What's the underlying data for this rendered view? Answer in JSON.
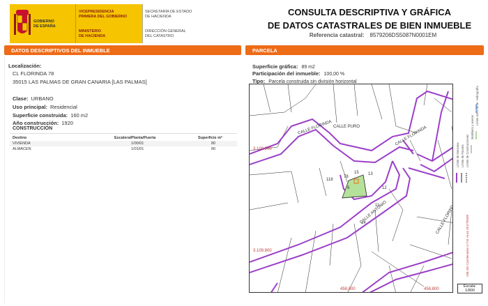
{
  "header": {
    "gobierno": "GOBIERNO\nDE ESPAÑA",
    "vicepresidencia": "VICEPRESIDENCIA\nPRIMERA DEL GOBIERNO",
    "ministerio": "MINISTERIO\nDE HACIENDA",
    "secretaria": "SECRETARÍA DE ESTADO\nDE HACIENDA",
    "direccion": "DIRECCIÓN GENERAL\nDEL CATASTRO",
    "title_line1": "CONSULTA DESCRIPTIVA Y GRÁFICA",
    "title_line2": "DE DATOS CATASTRALES DE BIEN INMUEBLE",
    "ref_label": "Referencia catastral:",
    "ref_value": "8579206DS5087N0001EM",
    "brand_yellow": "#f6c400",
    "accent_orange": "#ee6b17"
  },
  "left": {
    "section_title": "DATOS DESCRIPTIVOS DEL INMUEBLE",
    "localizacion_label": "Localización:",
    "address_line1": "CL FLORINDA 78",
    "address_line2": "35015 LAS PALMAS DE GRAN CANARIA [LAS PALMAS]",
    "clase_label": "Clase:",
    "clase_value": "URBANO",
    "uso_label": "Uso principal:",
    "uso_value": "Residencial",
    "superficie_label": "Superficie construida:",
    "superficie_value": "160 m2",
    "anio_label": "Año construcción:",
    "anio_value": "1920",
    "construccion_title": "CONSTRUCCIÓN",
    "table_headers": [
      "Destino",
      "Escalera/Planta/Puerta",
      "Superficie m²"
    ],
    "table_rows": [
      [
        "VIVIENDA",
        "1/00/01",
        "80"
      ],
      [
        "ALMACEN",
        "1/01/01",
        "80"
      ]
    ]
  },
  "right": {
    "section_title": "PARCELA",
    "sup_grafica_label": "Superficie gráfica:",
    "sup_grafica_value": "89 m2",
    "participacion_label": "Participación del inmueble:",
    "participacion_value": "100,00 %",
    "tipo_label": "Tipo:",
    "tipo_value": "Parcela construida sin división horizontal",
    "map_labels": {
      "coord_top_left": "3.109.900",
      "coord_bottom_left": "3.109.800",
      "coord_bottom_x1": "458,000",
      "coord_bottom_x2": "458,800",
      "street1": "CALLE FLORINDA",
      "street2": "CALLE PURO",
      "street3": "CALLE FLORINDA",
      "street4": "CALLE ANTONIO",
      "street5": "CALLE FLORINDA",
      "num_6": "6",
      "num_12": "12",
      "num_11": "11",
      "num_14": "14",
      "num_15": "15",
      "num_13": "13",
      "num_118": "118",
      "num_78": "78"
    },
    "legend_items": [
      "Límite de Manzana",
      "Límite de Parcela",
      "Límite de Construcciones",
      "Mobiliario y aceras",
      "Límite zona verde",
      "Hidrografía"
    ],
    "legend_coords": "-458.400 Coordenadas U.T.M. Huso 28 ETRS89",
    "escala_label": "Escala:",
    "escala_value": "1/800",
    "parcel_color": "#b5e29a",
    "block_color": "#9b3fc8"
  }
}
